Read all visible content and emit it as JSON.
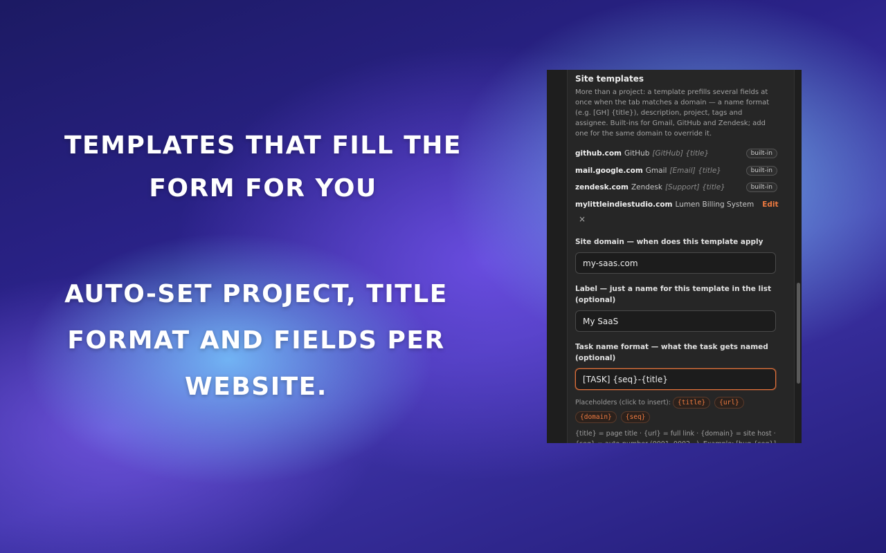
{
  "headline_top": "Templates that fill the form for you",
  "headline_bottom": "Auto-set project, title format and fields per website.",
  "panel": {
    "section_title": "Site templates",
    "description": "More than a project: a template prefills several fields at once when the tab matches a domain — a name format (e.g. [GH] {title}), description, project, tags and assignee. Built-ins for Gmail, GitHub and Zendesk; add one for the same domain to override it.",
    "templates": [
      {
        "domain": "github.com",
        "label": "GitHub",
        "format": "[GitHub] {title}",
        "badge": "built-in"
      },
      {
        "domain": "mail.google.com",
        "label": "Gmail",
        "format": "[Email] {title}",
        "badge": "built-in"
      },
      {
        "domain": "zendesk.com",
        "label": "Zendesk",
        "format": "[Support] {title}",
        "badge": "built-in"
      },
      {
        "domain": "mylittleindiestudio.com",
        "label": "Lumen Billing System",
        "format": "[...",
        "action": "Edit",
        "remove": "×"
      }
    ],
    "form": {
      "domain_label": "Site domain — when does this template apply",
      "domain_value": "my-saas.com",
      "label_label": "Label — just a name for this template in the list (optional)",
      "label_value": "My SaaS",
      "name_format_label": "Task name format — what the task gets named (optional)",
      "name_format_value": "[TASK] {seq}-{title}",
      "placeholders_label": "Placeholders (click to insert):",
      "placeholders": [
        "{title}",
        "{url}",
        "{domain}",
        "{seq}"
      ],
      "help_text": "{title} = page title · {url} = full link · {domain} = site host · {seq} = auto-number (0001, 0002...). Example:  [bug-{seq}]"
    },
    "colors": {
      "accent": "#f07b40",
      "panel_bg": "#262626"
    }
  }
}
